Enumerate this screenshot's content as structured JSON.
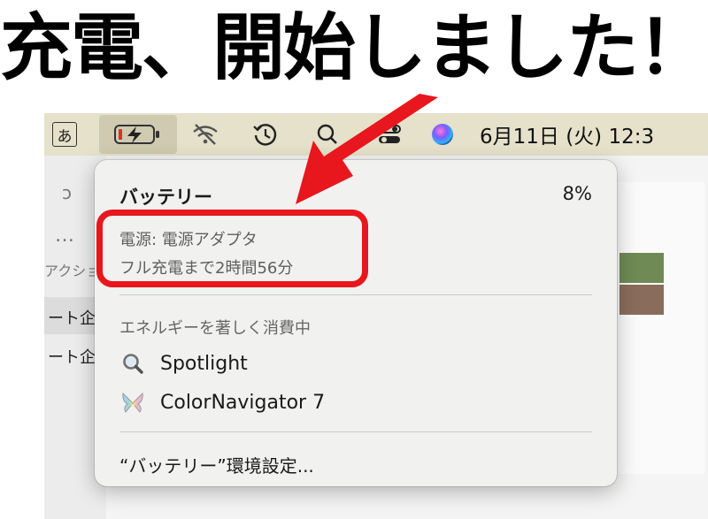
{
  "headline": "充電、開始しました！",
  "menubar": {
    "ime_label": "あ",
    "clock": "6月11日 (火)  12:3",
    "icons": [
      "ime-indicator",
      "battery-charging-icon",
      "wifi-off-icon",
      "time-machine-icon",
      "search-icon",
      "control-center-icon",
      "siri-icon"
    ]
  },
  "background": {
    "sidebar_top": "ɔ",
    "more_label": "…",
    "action_label": "アクション",
    "row1": "ート企",
    "row2": "ート企"
  },
  "battery_menu": {
    "title": "バッテリー",
    "percent": "8%",
    "power_source": "電源: 電源アダプタ",
    "time_to_full": "フル充電まで2時間56分",
    "energy_heading": "エネルギーを著しく消費中",
    "apps": [
      {
        "name": "Spotlight",
        "icon": "magnifier-icon"
      },
      {
        "name": "ColorNavigator 7",
        "icon": "colornavigator-icon"
      }
    ],
    "prefs_label": "“バッテリー”環境設定..."
  },
  "colors": {
    "menubar": "#e5e1ca",
    "menu_bg": "#f1f1ef",
    "annotation_red": "#e8161d",
    "battery_red": "#d9302a"
  }
}
